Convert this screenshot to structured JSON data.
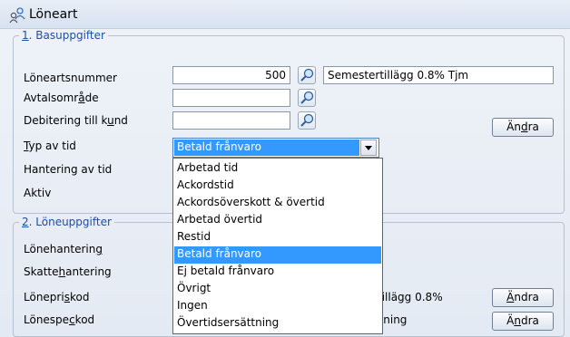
{
  "window": {
    "title": "Löneart"
  },
  "section1": {
    "legend_num": "1",
    "legend_text": ". Basuppgifter",
    "labels": {
      "nummer": "Löneartsnummer",
      "avtal_a": "Avtalsomr",
      "avtal_u": "å",
      "avtal_b": "de",
      "debit_a": "Debitering till k",
      "debit_u": "u",
      "debit_b": "nd",
      "typ_u": "T",
      "typ_b": "yp av tid",
      "hantering": "Hantering av tid",
      "aktiv": "Aktiv"
    },
    "nummer_value": "500",
    "description_value": "Semestertillägg 0.8%  Tjm",
    "avtal_value": "",
    "debit_value": "",
    "andra_a": "Än",
    "andra_u": "d",
    "andra_b": "ra",
    "typ_selected": "Betald frånvaro"
  },
  "section2": {
    "legend_num": "2",
    "legend_text": ". Löneuppgifter",
    "labels": {
      "lonehant_a": "Lönehanterin",
      "lonehant_u": "g",
      "skatt_a": "Skatte",
      "skatt_u": "h",
      "skatt_b": "antering",
      "lonepris_a": "Lönepri",
      "lonepris_u": "s",
      "lonepris_b": "kod",
      "lonespec_a": "Lönespe",
      "lonespec_u": "c",
      "lonespec_b": "kod"
    },
    "lonepris_desc": "tillägg 0.8%",
    "lonespec_desc": "sning",
    "andra1_u": "Ä",
    "andra1_b": "ndra",
    "andra2_a": "Ä",
    "andra2_u": "n",
    "andra2_b": "dra"
  },
  "dropdown_options": [
    "Arbetad tid",
    "Ackordstid",
    "Ackordsöverskott & övertid",
    "Arbetad övertid",
    "Restid",
    "Betald frånvaro",
    "Ej betald frånvaro",
    "Övrigt",
    "Ingen",
    "Övertidsersättning"
  ],
  "dropdown_selected_index": 5,
  "colors": {
    "accent": "#1d4fa6",
    "selection": "#3399ff"
  },
  "icons": {
    "window": "people-icon",
    "lookup": "magnifier-icon",
    "combo": "triangle-down-icon"
  }
}
